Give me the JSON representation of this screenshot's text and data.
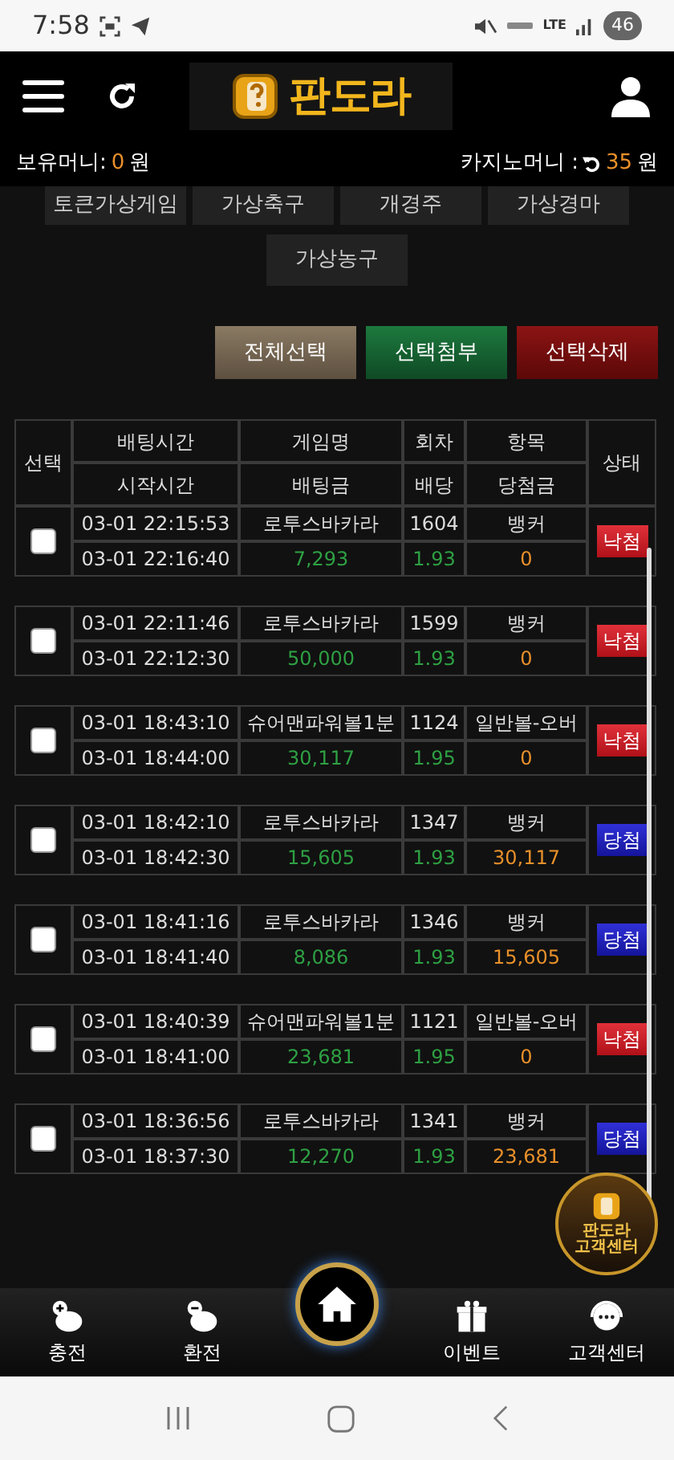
{
  "status_bar": {
    "time": "7:58",
    "network": "LTE",
    "battery": "46"
  },
  "header": {
    "logo": "판도라"
  },
  "balance": {
    "label": "보유머니:",
    "amount": "0",
    "unit": "원"
  },
  "casino": {
    "label": "카지노머니 :",
    "amount": "35",
    "unit": "원"
  },
  "categories": [
    "토큰가상게임",
    "가상축구",
    "개경주",
    "가상경마",
    "가상농구"
  ],
  "actions": [
    {
      "label": "전체선택",
      "kind": "select"
    },
    {
      "label": "선택첨부",
      "kind": "attach"
    },
    {
      "label": "선택삭제",
      "kind": "delete"
    }
  ],
  "table": {
    "columns": {
      "select": "선택",
      "bet_time": "배팅시간",
      "start_time": "시작시간",
      "game": "게임명",
      "bet_amount": "배팅금",
      "round": "회차",
      "odds": "배당",
      "pick": "항목",
      "payout": "당첨금",
      "state": "상태"
    },
    "rows": [
      {
        "checked": false,
        "bet_time": "03-01 22:15:53",
        "start_time": "03-01 22:16:40",
        "game": "로투스바카라",
        "bet_amount": "7,293",
        "round": "1604",
        "odds": "1.93",
        "pick": "뱅커",
        "payout": "0",
        "state": "낙첨",
        "kind": "lose"
      },
      {
        "checked": false,
        "bet_time": "03-01 22:11:46",
        "start_time": "03-01 22:12:30",
        "game": "로투스바카라",
        "bet_amount": "50,000",
        "round": "1599",
        "odds": "1.93",
        "pick": "뱅커",
        "payout": "0",
        "state": "낙첨",
        "kind": "lose"
      },
      {
        "checked": false,
        "bet_time": "03-01 18:43:10",
        "start_time": "03-01 18:44:00",
        "game": "슈어맨파워볼1분",
        "bet_amount": "30,117",
        "round": "1124",
        "odds": "1.95",
        "pick": "일반볼-오버",
        "payout": "0",
        "state": "낙첨",
        "kind": "lose"
      },
      {
        "checked": false,
        "bet_time": "03-01 18:42:10",
        "start_time": "03-01 18:42:30",
        "game": "로투스바카라",
        "bet_amount": "15,605",
        "round": "1347",
        "odds": "1.93",
        "pick": "뱅커",
        "payout": "30,117",
        "state": "당첨",
        "kind": "win"
      },
      {
        "checked": false,
        "bet_time": "03-01 18:41:16",
        "start_time": "03-01 18:41:40",
        "game": "로투스바카라",
        "bet_amount": "8,086",
        "round": "1346",
        "odds": "1.93",
        "pick": "뱅커",
        "payout": "15,605",
        "state": "당첨",
        "kind": "win"
      },
      {
        "checked": false,
        "bet_time": "03-01 18:40:39",
        "start_time": "03-01 18:41:00",
        "game": "슈어맨파워볼1분",
        "bet_amount": "23,681",
        "round": "1121",
        "odds": "1.95",
        "pick": "일반볼-오버",
        "payout": "0",
        "state": "낙첨",
        "kind": "lose"
      },
      {
        "checked": false,
        "bet_time": "03-01 18:36:56",
        "start_time": "03-01 18:37:30",
        "game": "로투스바카라",
        "bet_amount": "12,270",
        "round": "1341",
        "odds": "1.93",
        "pick": "뱅커",
        "payout": "23,681",
        "state": "당첨",
        "kind": "win"
      }
    ]
  },
  "support_badge": {
    "brand": "판도라",
    "label": "고객센터"
  },
  "bottom_nav": [
    {
      "label": "충전",
      "kind": "deposit"
    },
    {
      "label": "환전",
      "kind": "withdraw"
    },
    {
      "kind": "home"
    },
    {
      "label": "이벤트",
      "kind": "event"
    },
    {
      "label": "고객센터",
      "kind": "support"
    }
  ]
}
